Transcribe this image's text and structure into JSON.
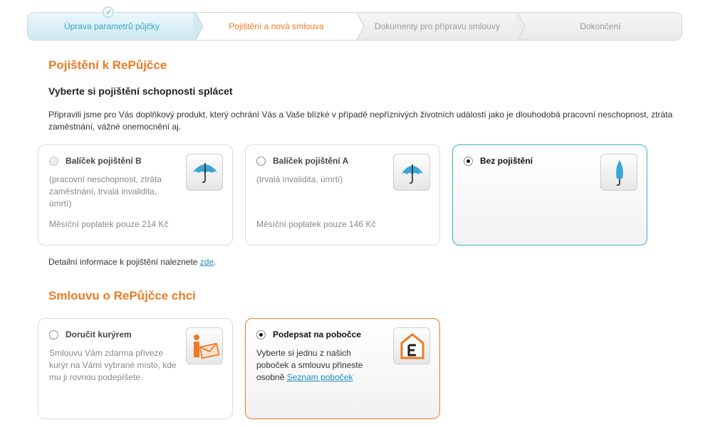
{
  "steps": [
    {
      "label": "Úprava parametrů půjčky",
      "state": "done"
    },
    {
      "label": "Pojištění a nová smlouva",
      "state": "active"
    },
    {
      "label": "Dokumenty pro přípravu smlouvy",
      "state": "todo"
    },
    {
      "label": "Dokončení",
      "state": "todo"
    }
  ],
  "insurance": {
    "title": "Pojištění k RePůjčce",
    "subtitle": "Vyberte si pojištění schopnosti splácet",
    "intro": "Připravili jsme pro Vás doplňkový produkt, který ochrání Vás a Vaše blízké v případě nepříznivých životních událostí jako je dlouhodobá pracovní neschopnost, ztráta zaměstnání, vážné onemocnění aj.",
    "options": [
      {
        "title": "Balíček pojištění B",
        "desc": "(pracovní neschopnost, ztráta zaměstnání, trvalá invalidita, úmrtí)",
        "fee": "Měsíční poplatek pouze 214 Kč",
        "icon": "umbrella-open-icon",
        "selected": false,
        "disabled": true
      },
      {
        "title": "Balíček pojištění A",
        "desc": "(trvalá invalidita, úmrtí)",
        "fee": "Měsíční poplatek pouze 146 Kč",
        "icon": "umbrella-open-icon",
        "selected": false,
        "disabled": false
      },
      {
        "title": "Bez pojištění",
        "desc": "",
        "fee": "",
        "icon": "umbrella-closed-icon",
        "selected": true,
        "disabled": false
      }
    ],
    "detail_prefix": "Detailní informace k pojištění naleznete ",
    "detail_link": "zde",
    "detail_suffix": "."
  },
  "contract": {
    "title": "Smlouvu o RePůjčce chci",
    "options": [
      {
        "title": "Doručit kurýrem",
        "desc": "Smlouvu Vám zdarma přiveze kurýr na Vámi vybrané místo, kde mu ji rovnou podepíšete.",
        "icon": "courier-envelope-icon",
        "selected": false
      },
      {
        "title": "Podepsat na pobočce",
        "desc": "Vyberte si jednu z našich poboček a smlouvu přineste osobně",
        "link": "Seznam poboček",
        "icon": "branch-house-icon",
        "selected": true
      }
    ]
  },
  "colors": {
    "accent": "#ee7a25",
    "active_blue": "#3bb0cc",
    "link": "#1a8fc0"
  }
}
